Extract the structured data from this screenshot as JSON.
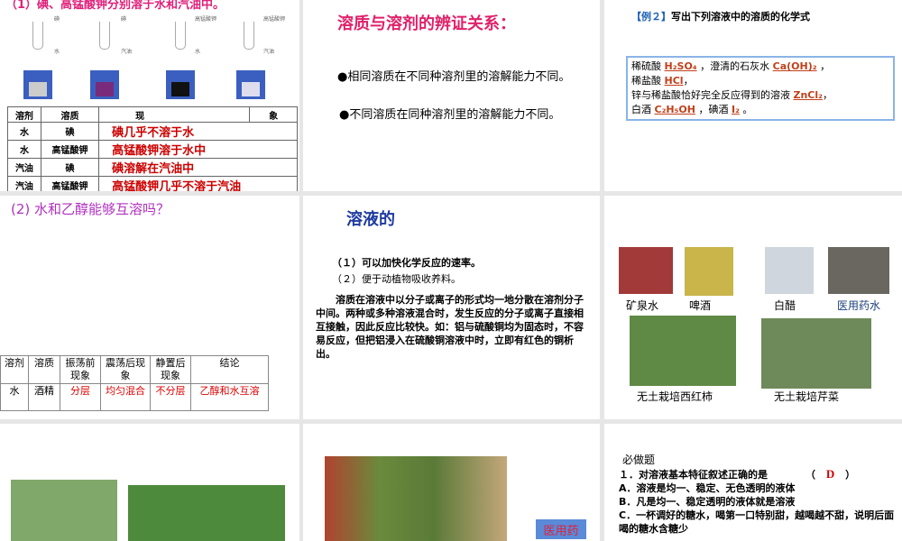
{
  "slide1": {
    "title": "（1）碘、高锰酸钾分别溶于水和汽油中。",
    "tube_labels": [
      {
        "top": "碘",
        "side": "水"
      },
      {
        "top": "碘",
        "side": "汽油"
      },
      {
        "top": "高锰酸钾",
        "side": "水"
      },
      {
        "top": "高锰酸钾",
        "side": "汽油"
      }
    ],
    "headers": [
      "溶剂",
      "溶质",
      "现",
      "象"
    ],
    "rows": [
      [
        "水",
        "碘",
        "碘几乎不溶于水"
      ],
      [
        "水",
        "高锰酸钾",
        "高锰酸钾溶于水中"
      ],
      [
        "汽油",
        "碘",
        "碘溶解在汽油中"
      ],
      [
        "汽油",
        "高锰酸钾",
        "高锰酸钾几乎不溶于汽油"
      ]
    ]
  },
  "slide2": {
    "title": "溶质与溶剂的辨证关系：",
    "bullets": [
      "●相同溶质在不同种溶剂里的溶解能力不同。",
      "●不同溶质在同种溶剂里的溶解能力不同。"
    ]
  },
  "slide3": {
    "title_bracket": "【例２】",
    "title": "写出下列溶液中的溶质的化学式",
    "l1a": "稀硫酸",
    "a1": "H₂SO₄",
    "l1b": "，澄清的石灰水",
    "a2": "Ca(OH)₂",
    "l1c": "，",
    "l2a": "稀盐酸",
    "a3": "HCl",
    "l2b": "，",
    "l3a": "锌与稀盐酸恰好完全反应得到的溶液",
    "a4": "ZnCl₂",
    "l3b": "，",
    "l4a": "白酒",
    "a5": "C₂H₅OH",
    "l4b": "，碘酒",
    "a6": "I₂",
    "l4c": "。"
  },
  "slide4": {
    "title": "(2) 水和乙醇能够互溶吗？",
    "headers": [
      "溶剂",
      "溶质",
      "振荡前现象",
      "震荡后现象",
      "静置后现象",
      "结论"
    ],
    "row": [
      "水",
      "酒精",
      "分层",
      "均匀混合",
      "不分层",
      "乙醇和水互溶"
    ]
  },
  "slide5": {
    "title": "溶液的",
    "points": [
      "（１）可以加快化学反应的速率。",
      "（２）便于动植物吸收养料。"
    ],
    "paragraph": "　　溶质在溶液中以分子或离子的形式均一地分散在溶剂分子中间。两种或多种溶液混合时，发生反应的分子或离子直接相互接触，因此反应比较快。如：铝与硫酸铜均为固态时，不容易反应，但把铝浸入在硫酸铜溶液中时，立即有红色的铜析出。"
  },
  "slide6": {
    "captions": [
      "矿泉水",
      "啤酒",
      "白醋",
      "医用药水",
      "无土栽培西红柿",
      "无土栽培芹菜"
    ]
  },
  "slide8": {
    "box_label": "医用药"
  },
  "slide9": {
    "heading": "必做题",
    "q": "１．对溶液基本特征叙述正确的是",
    "answer_open": "（",
    "answer": "D",
    "answer_close": "）",
    "options": [
      "A．溶液是均一、稳定、无色透明的液体",
      "B．凡是均一、稳定透明的液体就是溶液",
      "C．一杯调好的糖水，喝第一口特别甜，越喝越不甜，说明后面喝的糖水含糖少"
    ]
  }
}
